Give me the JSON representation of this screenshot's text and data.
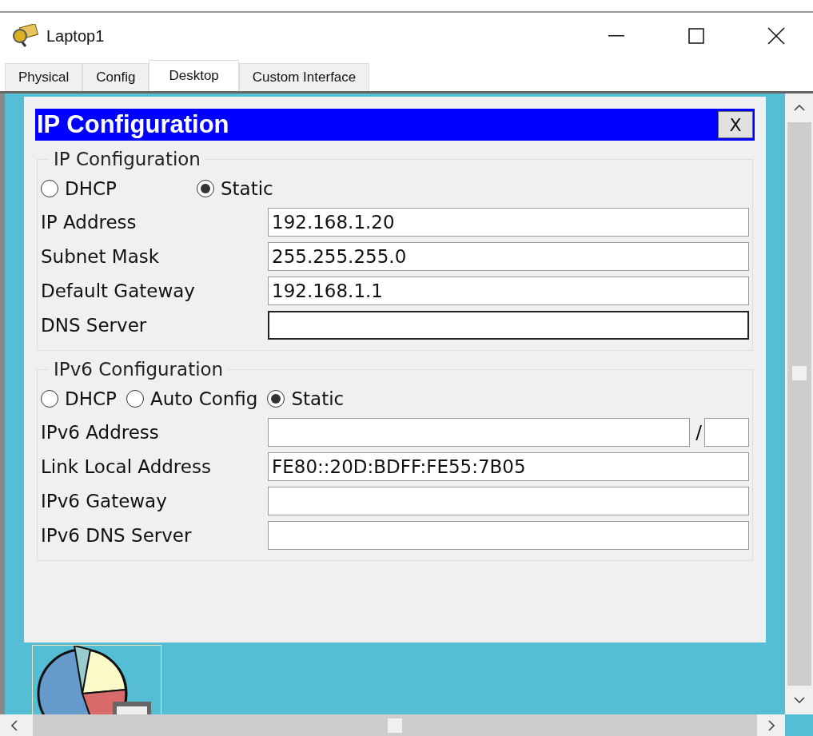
{
  "window": {
    "title": "Laptop1"
  },
  "tabs": [
    {
      "label": "Physical",
      "selected": false
    },
    {
      "label": "Config",
      "selected": false
    },
    {
      "label": "Desktop",
      "selected": true
    },
    {
      "label": "Custom Interface",
      "selected": false
    }
  ],
  "dialog": {
    "title": "IP Configuration",
    "close_label": "X",
    "ipv4": {
      "legend": "IP Configuration",
      "modes": [
        {
          "label": "DHCP",
          "selected": false
        },
        {
          "label": "Static",
          "selected": true
        }
      ],
      "fields": [
        {
          "label": "IP Address",
          "value": "192.168.1.20",
          "focused": false
        },
        {
          "label": "Subnet Mask",
          "value": "255.255.255.0",
          "focused": false
        },
        {
          "label": "Default Gateway",
          "value": "192.168.1.1",
          "focused": false
        },
        {
          "label": "DNS Server",
          "focused": true
        }
      ]
    },
    "ipv6": {
      "legend": "IPv6 Configuration",
      "modes": [
        {
          "label": "DHCP",
          "selected": false
        },
        {
          "label": "Auto Config",
          "selected": false
        },
        {
          "label": "Static",
          "selected": true
        }
      ],
      "prefix_separator": "/",
      "fields": [
        {
          "label": "IPv6 Address",
          "kind": "prefixed"
        },
        {
          "label": "Link Local Address",
          "value": "FE80::20D:BDFF:FE55:7B05",
          "kind": "plain"
        },
        {
          "label": "IPv6 Gateway",
          "kind": "plain"
        },
        {
          "label": "IPv6 DNS Server",
          "kind": "plain"
        }
      ]
    }
  }
}
